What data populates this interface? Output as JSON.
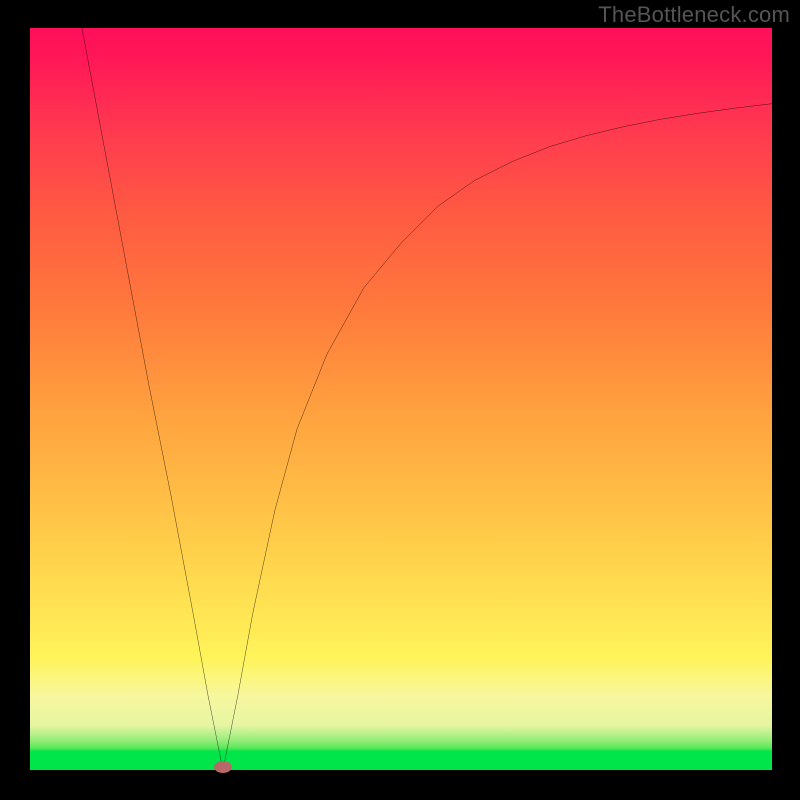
{
  "watermark": "TheBottleneck.com",
  "colors": {
    "frame": "#000000",
    "curve_stroke": "#000000",
    "minimum_dot": "#b86868",
    "gradient_top": "#ff0f5a",
    "gradient_bottom": "#00e64a"
  },
  "chart_data": {
    "type": "line",
    "title": "",
    "xlabel": "",
    "ylabel": "",
    "xlim": [
      0,
      100
    ],
    "ylim": [
      0,
      100
    ],
    "grid": false,
    "legend": false,
    "minimum_at_x": 26,
    "series": [
      {
        "name": "bottleneck-curve",
        "x": [
          7,
          10,
          13,
          16,
          19,
          22,
          24,
          26,
          28,
          30,
          33,
          36,
          40,
          45,
          50,
          55,
          60,
          65,
          70,
          75,
          80,
          85,
          90,
          95,
          100
        ],
        "y": [
          100,
          84,
          68,
          52,
          37,
          21,
          10,
          0,
          10,
          21,
          35,
          46,
          56,
          65,
          71,
          76,
          79.5,
          82,
          84,
          85.5,
          86.7,
          87.7,
          88.5,
          89.2,
          89.8
        ]
      }
    ],
    "annotations": [
      {
        "type": "dot",
        "x": 26,
        "y": 0,
        "label": "optimal-point"
      }
    ]
  }
}
